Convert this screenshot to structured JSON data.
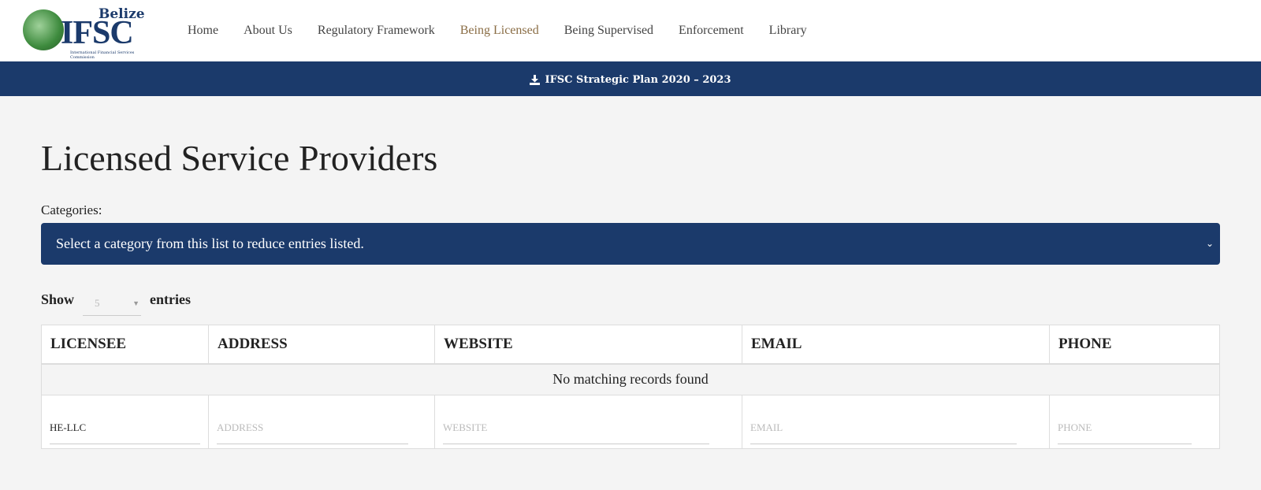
{
  "logo": {
    "top": "Belize",
    "main": "IFSC",
    "sub": "International Financial Services Commission"
  },
  "nav": [
    {
      "label": "Home"
    },
    {
      "label": "About Us"
    },
    {
      "label": "Regulatory Framework"
    },
    {
      "label": "Being Licensed",
      "active": true
    },
    {
      "label": "Being Supervised"
    },
    {
      "label": "Enforcement"
    },
    {
      "label": "Library"
    }
  ],
  "banner": {
    "icon": "download-icon",
    "label": "IFSC Strategic Plan 2020 – 2023"
  },
  "page_title": "Licensed Service Providers",
  "categories": {
    "label": "Categories:",
    "selected": "Select a category from this list to reduce entries listed."
  },
  "length": {
    "show": "Show",
    "value": "5",
    "entries": "entries"
  },
  "table": {
    "headers": [
      "LICENSEE",
      "ADDRESS",
      "WEBSITE",
      "EMAIL",
      "PHONE"
    ],
    "empty": "No matching records found",
    "filters": [
      {
        "value": "HE-LLC",
        "placeholder": ""
      },
      {
        "value": "",
        "placeholder": "ADDRESS"
      },
      {
        "value": "",
        "placeholder": "WEBSITE"
      },
      {
        "value": "",
        "placeholder": "EMAIL"
      },
      {
        "value": "",
        "placeholder": "PHONE"
      }
    ]
  },
  "colors": {
    "primary": "#1b3a6b",
    "active_nav": "#8a6d45"
  }
}
